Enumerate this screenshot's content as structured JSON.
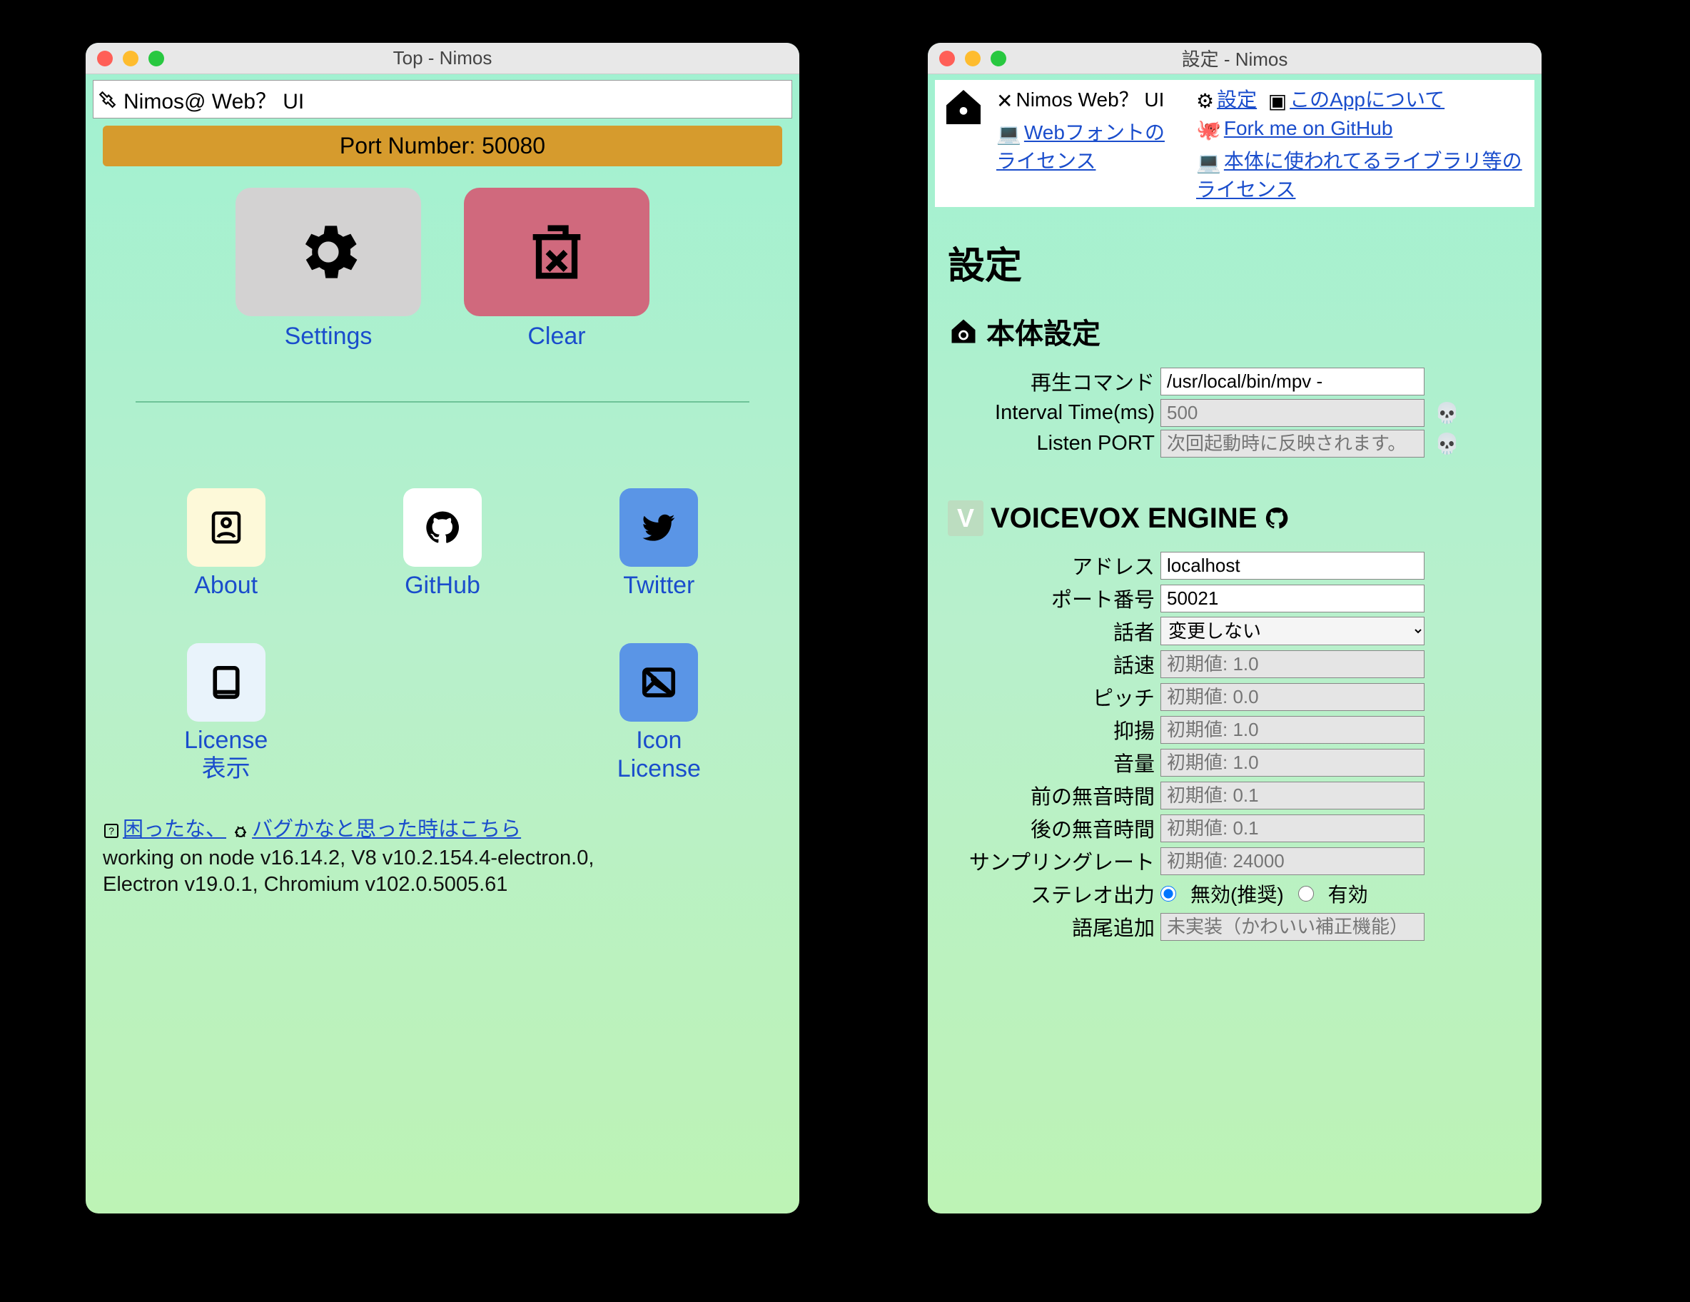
{
  "window1": {
    "title": "Top - Nimos",
    "toolbar_label": "Nimos@ Web？ UI",
    "port_banner": "Port Number: 50080",
    "tiles": {
      "settings": "Settings",
      "clear": "Clear",
      "about": "About",
      "github": "GitHub",
      "twitter": "Twitter",
      "license": "License\n表示",
      "iconlicense": "Icon\nLicense"
    },
    "footer_link1": "困ったな、",
    "footer_link2": "バグかなと思った時はこちら",
    "ver_line1": "working on node v16.14.2,    V8 v10.2.154.4-electron.0,",
    "ver_line2": "Electron v19.0.1,    Chromium v102.0.5005.61"
  },
  "window2": {
    "title": "設定 - Nimos",
    "nav": {
      "brand": "Nimos Web？ UI",
      "webfont": "Webフォントのライセンス",
      "settings": "設定",
      "about_app": "このAppについて",
      "fork": "Fork me on GitHub",
      "liblic": "本体に使われてるライブラリ等のライセンス"
    },
    "h1": "設定",
    "h2_main": "本体設定",
    "main": {
      "play_cmd_label": "再生コマンド",
      "play_cmd_value": "/usr/local/bin/mpv -",
      "interval_label": "Interval Time(ms)",
      "interval_value": "500",
      "listen_label": "Listen PORT",
      "listen_placeholder": "次回起動時に反映されます。"
    },
    "h2_vv": "VOICEVOX ENGINE",
    "vv": {
      "addr_label": "アドレス",
      "addr_value": "localhost",
      "port_label": "ポート番号",
      "port_value": "50021",
      "speaker_label": "話者",
      "speaker_value": "変更しない",
      "speed_label": "話速",
      "speed_ph": "初期値: 1.0",
      "pitch_label": "ピッチ",
      "pitch_ph": "初期値: 0.0",
      "intonation_label": "抑揚",
      "intonation_ph": "初期値: 1.0",
      "volume_label": "音量",
      "volume_ph": "初期値: 1.0",
      "presilence_label": "前の無音時間",
      "presilence_ph": "初期値: 0.1",
      "postsilence_label": "後の無音時間",
      "postsilence_ph": "初期値: 0.1",
      "sample_label": "サンプリングレート",
      "sample_ph": "初期値: 24000",
      "stereo_label": "ステレオ出力",
      "stereo_off": "無効(推奨)",
      "stereo_on": "有効",
      "suffix_label": "語尾追加",
      "suffix_ph": "未実装（かわいい補正機能）"
    }
  }
}
